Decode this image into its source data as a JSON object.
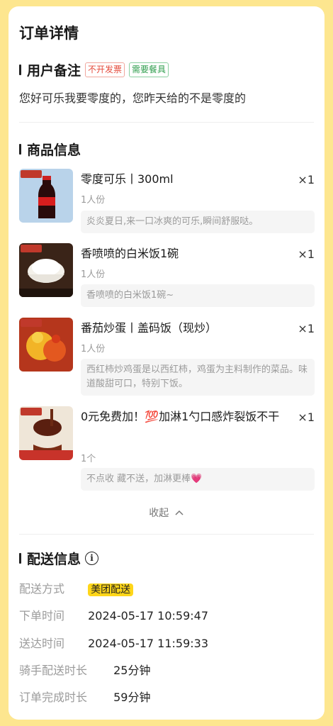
{
  "page": {
    "title": "订单详情"
  },
  "remark": {
    "section_title": "用户备注",
    "tags": [
      "不开发票",
      "需要餐具"
    ],
    "note": "您好可乐我要零度的，您昨天给的不是零度的"
  },
  "goods": {
    "section_title": "商品信息",
    "items": [
      {
        "name": "零度可乐丨300ml",
        "qty": "×1",
        "unit": "1人份",
        "desc": "炎炎夏日,来一口冰爽的可乐,瞬间舒服哒。",
        "thumb_icon": "cola-bottle-image"
      },
      {
        "name": "香喷喷的白米饭1碗",
        "qty": "×1",
        "unit": "1人份",
        "desc": "香喷喷的白米饭1碗~",
        "thumb_icon": "white-rice-image"
      },
      {
        "name": "番茄炒蛋丨盖码饭（现炒）",
        "qty": "×1",
        "unit": "1人份",
        "desc": "西红柿炒鸡蛋是以西红柿，鸡蛋为主料制作的菜品。味道酸甜可口，特别下饭。",
        "thumb_icon": "tomato-egg-image"
      },
      {
        "name": "0元免费加！💯加淋1勺口感炸裂饭不干",
        "qty": "×1",
        "unit": "1个",
        "desc": "不点收 藏不送，加淋更棒💗",
        "thumb_icon": "sauce-spoon-image"
      }
    ],
    "collapse_label": "收起"
  },
  "delivery": {
    "section_title": "配送信息",
    "rows": [
      {
        "label": "配送方式",
        "value": "美团配送"
      },
      {
        "label": "下单时间",
        "value": "2024-05-17 10:59:47"
      },
      {
        "label": "送达时间",
        "value": "2024-05-17 11:59:33"
      },
      {
        "label": "骑手配送时长",
        "value": "25分钟"
      },
      {
        "label": "订单完成时长",
        "value": "59分钟"
      }
    ]
  },
  "colors": {
    "background": "#fde68f",
    "badge": "#ffd619",
    "tag_red": "#e54b3c",
    "tag_green": "#2f9e4e"
  }
}
